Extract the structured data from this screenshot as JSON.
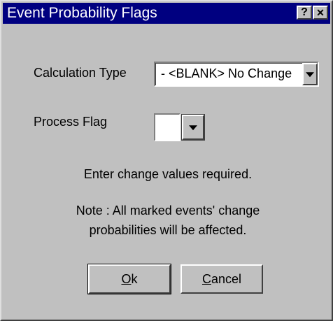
{
  "window": {
    "title": "Event Probability Flags",
    "help_glyph": "?",
    "close_glyph": "✕"
  },
  "calculation_type": {
    "label": "Calculation Type",
    "value": " -  <BLANK> No Change"
  },
  "process_flag": {
    "label": "Process Flag",
    "value": ""
  },
  "messages": {
    "instruction": "Enter change values required.",
    "note_line1": "Note : All marked events' change",
    "note_line2": "probabilities will be affected."
  },
  "buttons": {
    "ok": "Ok",
    "cancel": "Cancel"
  }
}
